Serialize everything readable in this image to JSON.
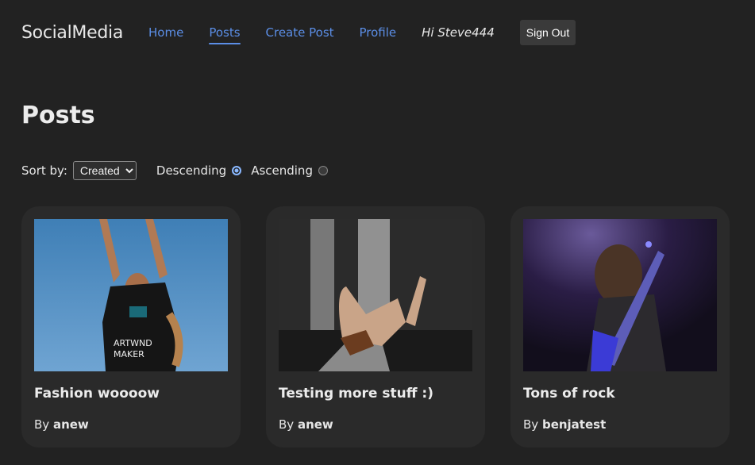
{
  "nav": {
    "brand": "SocialMedia",
    "links": [
      {
        "label": "Home",
        "active": false
      },
      {
        "label": "Posts",
        "active": true
      },
      {
        "label": "Create Post",
        "active": false
      },
      {
        "label": "Profile",
        "active": false
      }
    ],
    "greeting": "Hi Steve444",
    "sign_out": "Sign Out"
  },
  "page": {
    "title": "Posts",
    "sort_label": "Sort by:",
    "sort_value": "Created",
    "descending_label": "Descending",
    "ascending_label": "Ascending",
    "order": "descending"
  },
  "colors": {
    "accent": "#5b8ee6",
    "background": "#222222",
    "card": "#2a2a2a"
  },
  "posts": [
    {
      "title": "Fashion woooow",
      "by_prefix": "By",
      "author": "anew",
      "image": "woman-in-black-tshirt-blue-sky"
    },
    {
      "title": "Testing more stuff :)",
      "by_prefix": "By",
      "author": "anew",
      "image": "hand-gesture-waterfall"
    },
    {
      "title": "Tons of rock",
      "by_prefix": "By",
      "author": "benjatest",
      "image": "guitarist-on-stage"
    }
  ]
}
